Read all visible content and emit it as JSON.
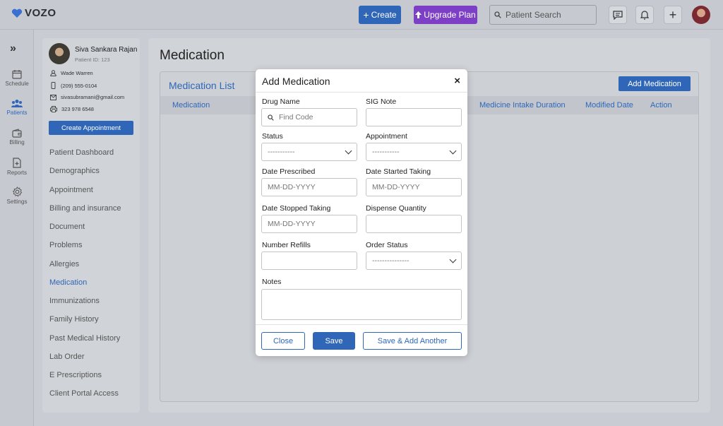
{
  "app": {
    "name": "VOZO"
  },
  "topbar": {
    "create_label": "Create",
    "upgrade_label": "Upgrade Plan",
    "search_placeholder": "Patient Search"
  },
  "leftnav": {
    "items": [
      {
        "label": "Schedule",
        "icon": "calendar-icon"
      },
      {
        "label": "Patients",
        "icon": "patients-icon"
      },
      {
        "label": "Billing",
        "icon": "wallet-icon"
      },
      {
        "label": "Reports",
        "icon": "report-icon"
      },
      {
        "label": "Settings",
        "icon": "gear-icon"
      }
    ],
    "active": "Patients"
  },
  "patient": {
    "name": "Siva Sankara Rajan",
    "id_text": "Patient ID: 123",
    "provider": "Wade Warren",
    "phone": "(209) 555-0104",
    "email": "sivasubramani@gmail.com",
    "fax": "323 978 6548",
    "create_appointment_label": "Create Appointment"
  },
  "patient_menu": {
    "items": [
      "Patient Dashboard",
      "Demographics",
      "Appointment",
      "Billing and insurance",
      "Document",
      "Problems",
      "Allergies",
      "Medication",
      "Immunizations",
      "Family History",
      "Past Medical History",
      "Lab Order",
      "E Prescriptions",
      "Client Portal Access"
    ],
    "active": "Medication"
  },
  "main": {
    "title": "Medication",
    "card_title": "Medication List",
    "add_button": "Add Medication",
    "columns": [
      "Medication",
      "Medicine Intake Duration",
      "Modified Date",
      "Action"
    ]
  },
  "modal": {
    "title": "Add Medication",
    "close_glyph": "×",
    "fields": {
      "drug_name": {
        "label": "Drug Name",
        "placeholder": "Find Code"
      },
      "sig_note": {
        "label": "SIG Note",
        "value": ""
      },
      "status": {
        "label": "Status",
        "selected": "-----------"
      },
      "appointment": {
        "label": "Appointment",
        "selected": "-----------"
      },
      "date_prescribed": {
        "label": "Date Prescribed",
        "placeholder": "MM-DD-YYYY"
      },
      "date_started": {
        "label": "Date Started Taking",
        "placeholder": "MM-DD-YYYY"
      },
      "date_stopped": {
        "label": "Date Stopped Taking",
        "placeholder": "MM-DD-YYYY"
      },
      "dispense_quantity": {
        "label": "Dispense Quantity",
        "value": ""
      },
      "number_refills": {
        "label": "Number Refills",
        "value": ""
      },
      "order_status": {
        "label": "Order Status",
        "selected": "---------------"
      },
      "notes": {
        "label": "Notes",
        "value": ""
      }
    },
    "buttons": {
      "close": "Close",
      "save": "Save",
      "save_add_another": "Save & Add Another"
    }
  },
  "colors": {
    "primary": "#2f66b8",
    "upgrade": "#7d3fc5",
    "overlay_bg": "#c9ccd2",
    "logo_heart": "#3b6fd1"
  }
}
